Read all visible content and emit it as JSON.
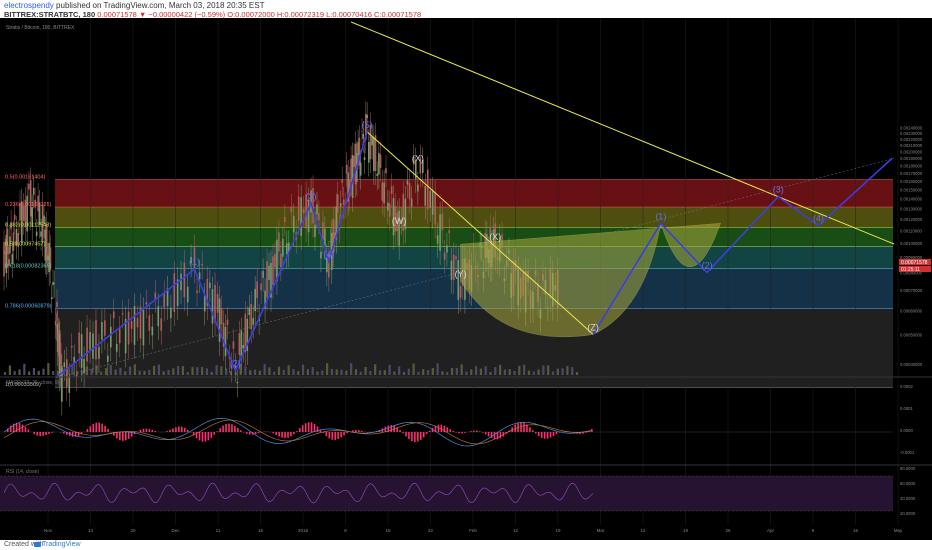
{
  "header": {
    "author": "electrospendy",
    "published": "published on TradingView.com, March 03, 2018 20:35 EST",
    "symbol": "BITTREX:STRATBTC, 180",
    "quote": "0.00071578 ▼ −0.00000422 (−0.59%) O:0.00072000 H:0.00072319 L:0.00070416 C:0.00071578"
  },
  "footer": {
    "created_with": "Created with",
    "brand": "TradingView"
  },
  "colors": {
    "fib_red": "#7a1418",
    "fib_olive": "#5c5d12",
    "fib_green": "#1d5a1a",
    "fib_teal": "#14504d",
    "fib_blue": "#183954",
    "fib_gray": "#262626",
    "fib_navy": "#181a5e",
    "wave_line": "#3d3de0",
    "trend_line": "#e8e84a",
    "pattern_fill": "#a8a83c",
    "macd_hist": "#ff2d6e"
  },
  "chart_data": {
    "type": "line",
    "title": "Stratis / Bitcoin, 180, BITTREX",
    "x_tick_labels": [
      "Nov",
      "13",
      "20",
      "Dec",
      "11",
      "18",
      "2018",
      "8",
      "15",
      "22",
      "Feb",
      "12",
      "19",
      "Mar",
      "12",
      "19",
      "26",
      "Apr",
      "9",
      "16",
      "May"
    ],
    "y_tick_labels": [
      "0.00240000",
      "0.00230000",
      "0.00220000",
      "0.00210000",
      "0.00200000",
      "0.00190000",
      "0.00180000",
      "0.00170000",
      "0.00160000",
      "0.00150000",
      "0.00140000",
      "0.00130000",
      "0.00120000",
      "0.00110000",
      "0.00100000",
      "0.00090000",
      "0.00080000",
      "0.00070000",
      "0.00060000",
      "0.00050000",
      "0.00040000",
      "0.00030000"
    ],
    "ylim": [
      0.0002,
      0.0025
    ],
    "last_price": "0.00071578",
    "countdown": "01:25:11",
    "fib_levels": [
      {
        "label": "0.5(0.00161404)",
        "value": 0.00161404
      },
      {
        "label": "0.236(0.00131225)",
        "value": 0.00131225
      },
      {
        "label": "0.382(0.00112548)",
        "value": 0.00112548
      },
      {
        "label": "0.5(0.00097457)",
        "value": 0.00097457
      },
      {
        "label": "0.618(0.00082365)",
        "value": 0.00082365
      },
      {
        "label": "0.786(0.00060879)",
        "value": 0.00060879
      },
      {
        "label": "1(0.00033509)",
        "value": 0.00033509
      }
    ],
    "wave_labels": [
      {
        "label": "(1)",
        "t": 0.214,
        "v": 0.00082
      },
      {
        "label": "(2)",
        "t": 0.26,
        "v": 0.00038
      },
      {
        "label": "(3)",
        "t": 0.345,
        "v": 0.00135
      },
      {
        "label": "(4)",
        "t": 0.365,
        "v": 0.00087
      },
      {
        "label": "(5)",
        "t": 0.408,
        "v": 0.00232
      },
      {
        "label": "(X)",
        "t": 0.465,
        "v": 0.0018
      },
      {
        "label": "(W)",
        "t": 0.444,
        "v": 0.00112
      },
      {
        "label": "(X)",
        "t": 0.552,
        "v": 0.00099
      },
      {
        "label": "(Y)",
        "t": 0.513,
        "v": 0.00075
      },
      {
        "label": "(Z)",
        "t": 0.662,
        "v": 0.0005
      },
      {
        "label": "(1)",
        "t": 0.738,
        "v": 0.00116
      },
      {
        "label": "(2)",
        "t": 0.79,
        "v": 0.0008
      },
      {
        "label": "(3)",
        "t": 0.87,
        "v": 0.00142
      },
      {
        "label": "(4)",
        "t": 0.915,
        "v": 0.00114
      }
    ],
    "indicators": [
      {
        "name": "MACD (12, 26, close, 9)",
        "ticks": [
          "0.0002",
          "0.0001",
          "0.0000",
          "-0.0001"
        ]
      },
      {
        "name": "RSI (14, close)",
        "ticks": [
          "80.0000",
          "60.0000",
          "40.0000",
          "20.0000"
        ]
      }
    ]
  }
}
